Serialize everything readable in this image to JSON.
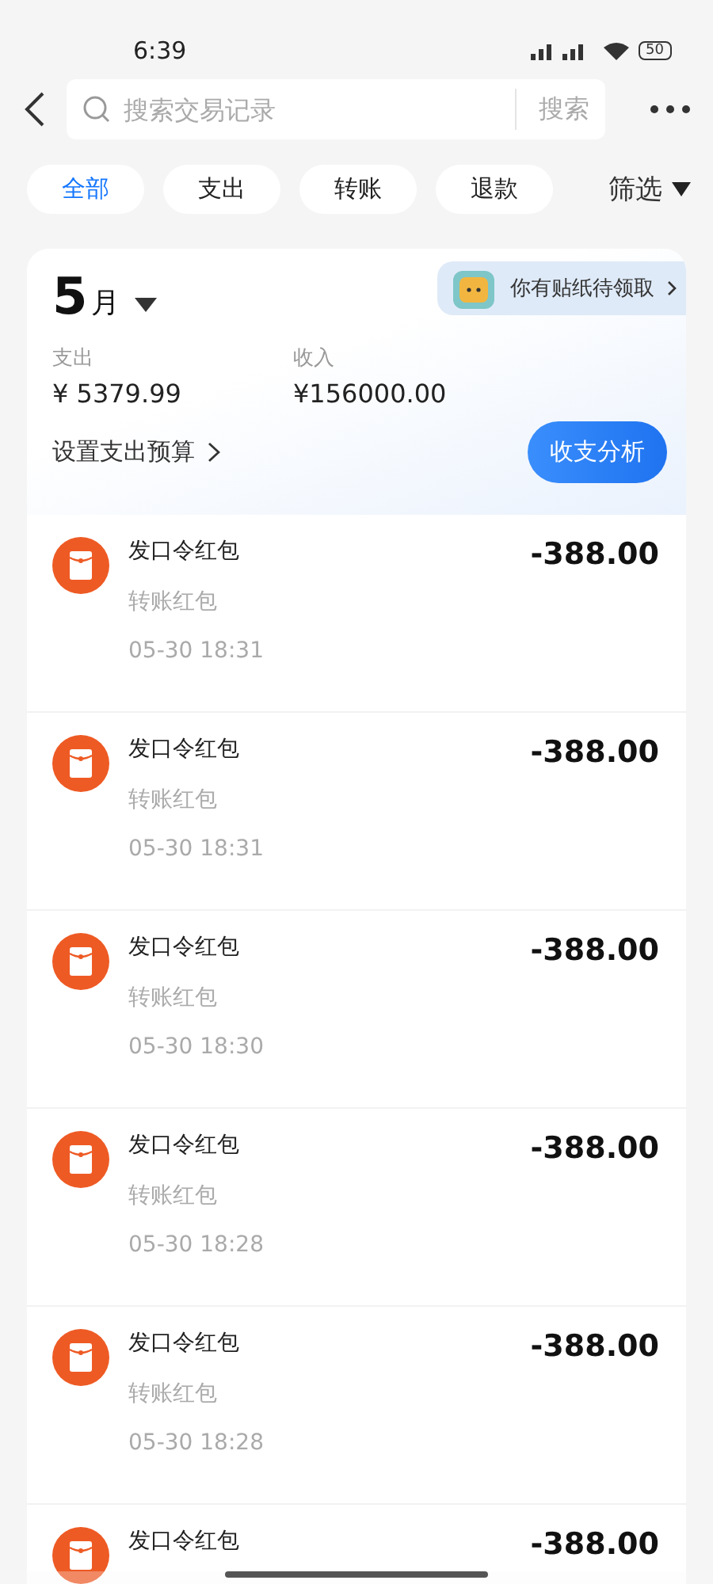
{
  "status_bar": {
    "time": "6:39",
    "battery": "50"
  },
  "search": {
    "placeholder": "搜索交易记录",
    "button": "搜索"
  },
  "filters": [
    {
      "label": "全部",
      "selected": true
    },
    {
      "label": "支出",
      "selected": false
    },
    {
      "label": "转账",
      "selected": false
    },
    {
      "label": "退款",
      "selected": false
    }
  ],
  "filter_menu": "筛选",
  "summary": {
    "month": "5",
    "month_unit": "月",
    "sticker_banner": "你有贴纸待领取",
    "expense_label": "支出",
    "expense": "¥ 5379.99",
    "income_label": "收入",
    "income": "¥156000.00",
    "budget_link": "设置支出预算",
    "analysis_button": "收支分析"
  },
  "transactions": [
    {
      "title": "发口令红包",
      "category": "转账红包",
      "time": "05-30 18:31",
      "amount": "-388.00"
    },
    {
      "title": "发口令红包",
      "category": "转账红包",
      "time": "05-30 18:31",
      "amount": "-388.00"
    },
    {
      "title": "发口令红包",
      "category": "转账红包",
      "time": "05-30 18:30",
      "amount": "-388.00"
    },
    {
      "title": "发口令红包",
      "category": "转账红包",
      "time": "05-30 18:28",
      "amount": "-388.00"
    },
    {
      "title": "发口令红包",
      "category": "转账红包",
      "time": "05-30 18:28",
      "amount": "-388.00"
    },
    {
      "title": "发口令红包",
      "amount": "-388.00"
    }
  ]
}
